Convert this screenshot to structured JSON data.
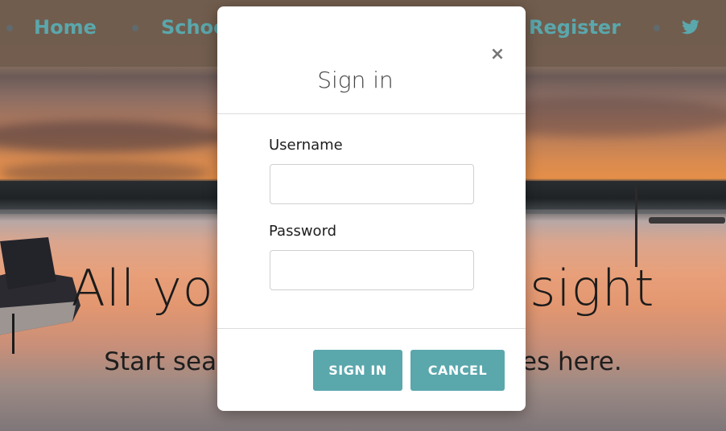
{
  "nav": {
    "items": [
      {
        "label": "Home"
      },
      {
        "label": "Schools"
      },
      {
        "label": "Register"
      }
    ],
    "twitter_icon": "twitter-icon",
    "link_color": "#5aa7ac"
  },
  "hero": {
    "title": "All your dream in sight",
    "subtitle": "Start searching for new possibilities here."
  },
  "modal": {
    "title": "Sign in",
    "close_label": "×",
    "username_label": "Username",
    "username_value": "",
    "username_placeholder": "",
    "password_label": "Password",
    "password_value": "",
    "password_placeholder": "",
    "signin_label": "SIGN IN",
    "cancel_label": "CANCEL",
    "button_color": "#5aa7ac"
  }
}
